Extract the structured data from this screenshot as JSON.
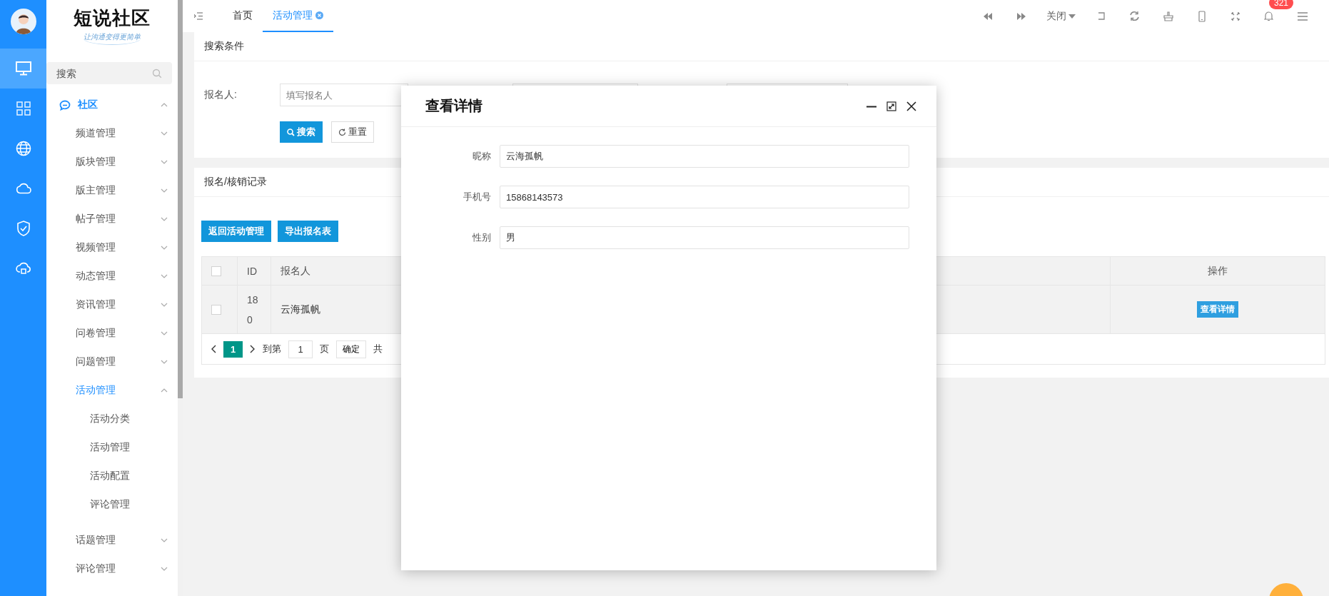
{
  "icon_rail": {
    "items": [
      {
        "kind": "monitor",
        "selected": true
      },
      {
        "kind": "grid",
        "selected": false
      },
      {
        "kind": "globe",
        "selected": false
      },
      {
        "kind": "cloud",
        "selected": false
      },
      {
        "kind": "shield",
        "selected": false
      },
      {
        "kind": "cloud-lock",
        "selected": false
      }
    ]
  },
  "brand": {
    "name": "短说社区",
    "slogan": "让沟通变得更简单"
  },
  "menu_search": {
    "placeholder": "搜索"
  },
  "menu": [
    {
      "label": "社区",
      "expanded": true,
      "children": [
        {
          "label": "频道管理",
          "expanded": false
        },
        {
          "label": "版块管理",
          "expanded": false
        },
        {
          "label": "版主管理",
          "expanded": false
        },
        {
          "label": "帖子管理",
          "expanded": false
        },
        {
          "label": "视频管理",
          "expanded": false
        },
        {
          "label": "动态管理",
          "expanded": false
        },
        {
          "label": "资讯管理",
          "expanded": false
        },
        {
          "label": "问卷管理",
          "expanded": false
        },
        {
          "label": "问题管理",
          "expanded": false
        },
        {
          "label": "活动管理",
          "expanded": true,
          "children": [
            {
              "label": "活动分类"
            },
            {
              "label": "活动管理"
            },
            {
              "label": "活动配置"
            },
            {
              "label": "评论管理"
            }
          ]
        },
        {
          "label": "话题管理",
          "expanded": false
        },
        {
          "label": "评论管理",
          "expanded": false
        }
      ]
    }
  ],
  "topbar": {
    "tabs": [
      {
        "label": "首页",
        "selected": false,
        "closable": false
      },
      {
        "label": "活动管理",
        "selected": true,
        "closable": true
      }
    ],
    "close_menu": "关闭",
    "notification_badge": "321"
  },
  "search_card": {
    "title": "搜索条件",
    "fields": [
      {
        "label": "报名人:",
        "placeholder": "填写报名人"
      }
    ],
    "buttons": [
      {
        "label": "搜索",
        "kind": "primary"
      },
      {
        "label": "重置",
        "kind": "default"
      }
    ]
  },
  "records_card": {
    "title": "报名/核销记录",
    "buttons": [
      "返回活动管理",
      "导出报名表"
    ],
    "table": {
      "header_checked": false,
      "columns": [
        "ID",
        "报名人",
        "操作"
      ],
      "rows": [
        {
          "checked": false,
          "highlighted": true,
          "id": "180",
          "name": "云海孤帆",
          "action": "查看详情"
        }
      ]
    },
    "pagination": {
      "pages": [
        {
          "label": "1",
          "selected": true
        }
      ],
      "goto_label": "到第",
      "page_input": "1",
      "page_unit": "页",
      "confirm": "确定",
      "total": "共"
    }
  },
  "modal": {
    "title": "查看详情",
    "fields": [
      {
        "label": "昵称",
        "value": "云海孤帆"
      },
      {
        "label": "手机号",
        "value": "15868143573"
      },
      {
        "label": "性别",
        "value": "男"
      }
    ]
  }
}
